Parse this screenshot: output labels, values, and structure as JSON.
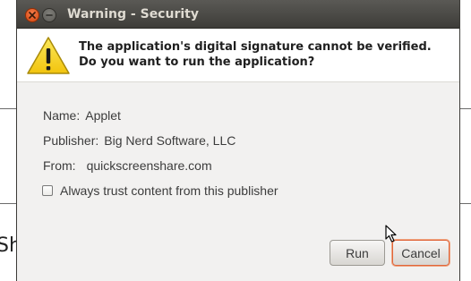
{
  "window": {
    "title": "Warning - Security",
    "close_icon": "close-icon",
    "minimize_icon": "minimize-icon"
  },
  "header": {
    "icon": "warning-icon",
    "message": "The application's digital signature cannot be verified. Do you want to run the application?"
  },
  "details": {
    "name_label": "Name:",
    "name_value": "Applet",
    "publisher_label": "Publisher:",
    "publisher_value": "Big Nerd Software, LLC",
    "from_label": "From:",
    "from_value": "quickscreenshare.com"
  },
  "trust_checkbox": {
    "label": "Always trust content from this publisher",
    "checked": false
  },
  "buttons": {
    "run_label": "Run",
    "cancel_label": "Cancel"
  },
  "background": {
    "partial_text": "Sh"
  },
  "colors": {
    "titlebar": "#3e3d39",
    "close_button": "#e3551c",
    "dialog_bg": "#f2f1f0",
    "focus_ring": "#e0663a"
  }
}
